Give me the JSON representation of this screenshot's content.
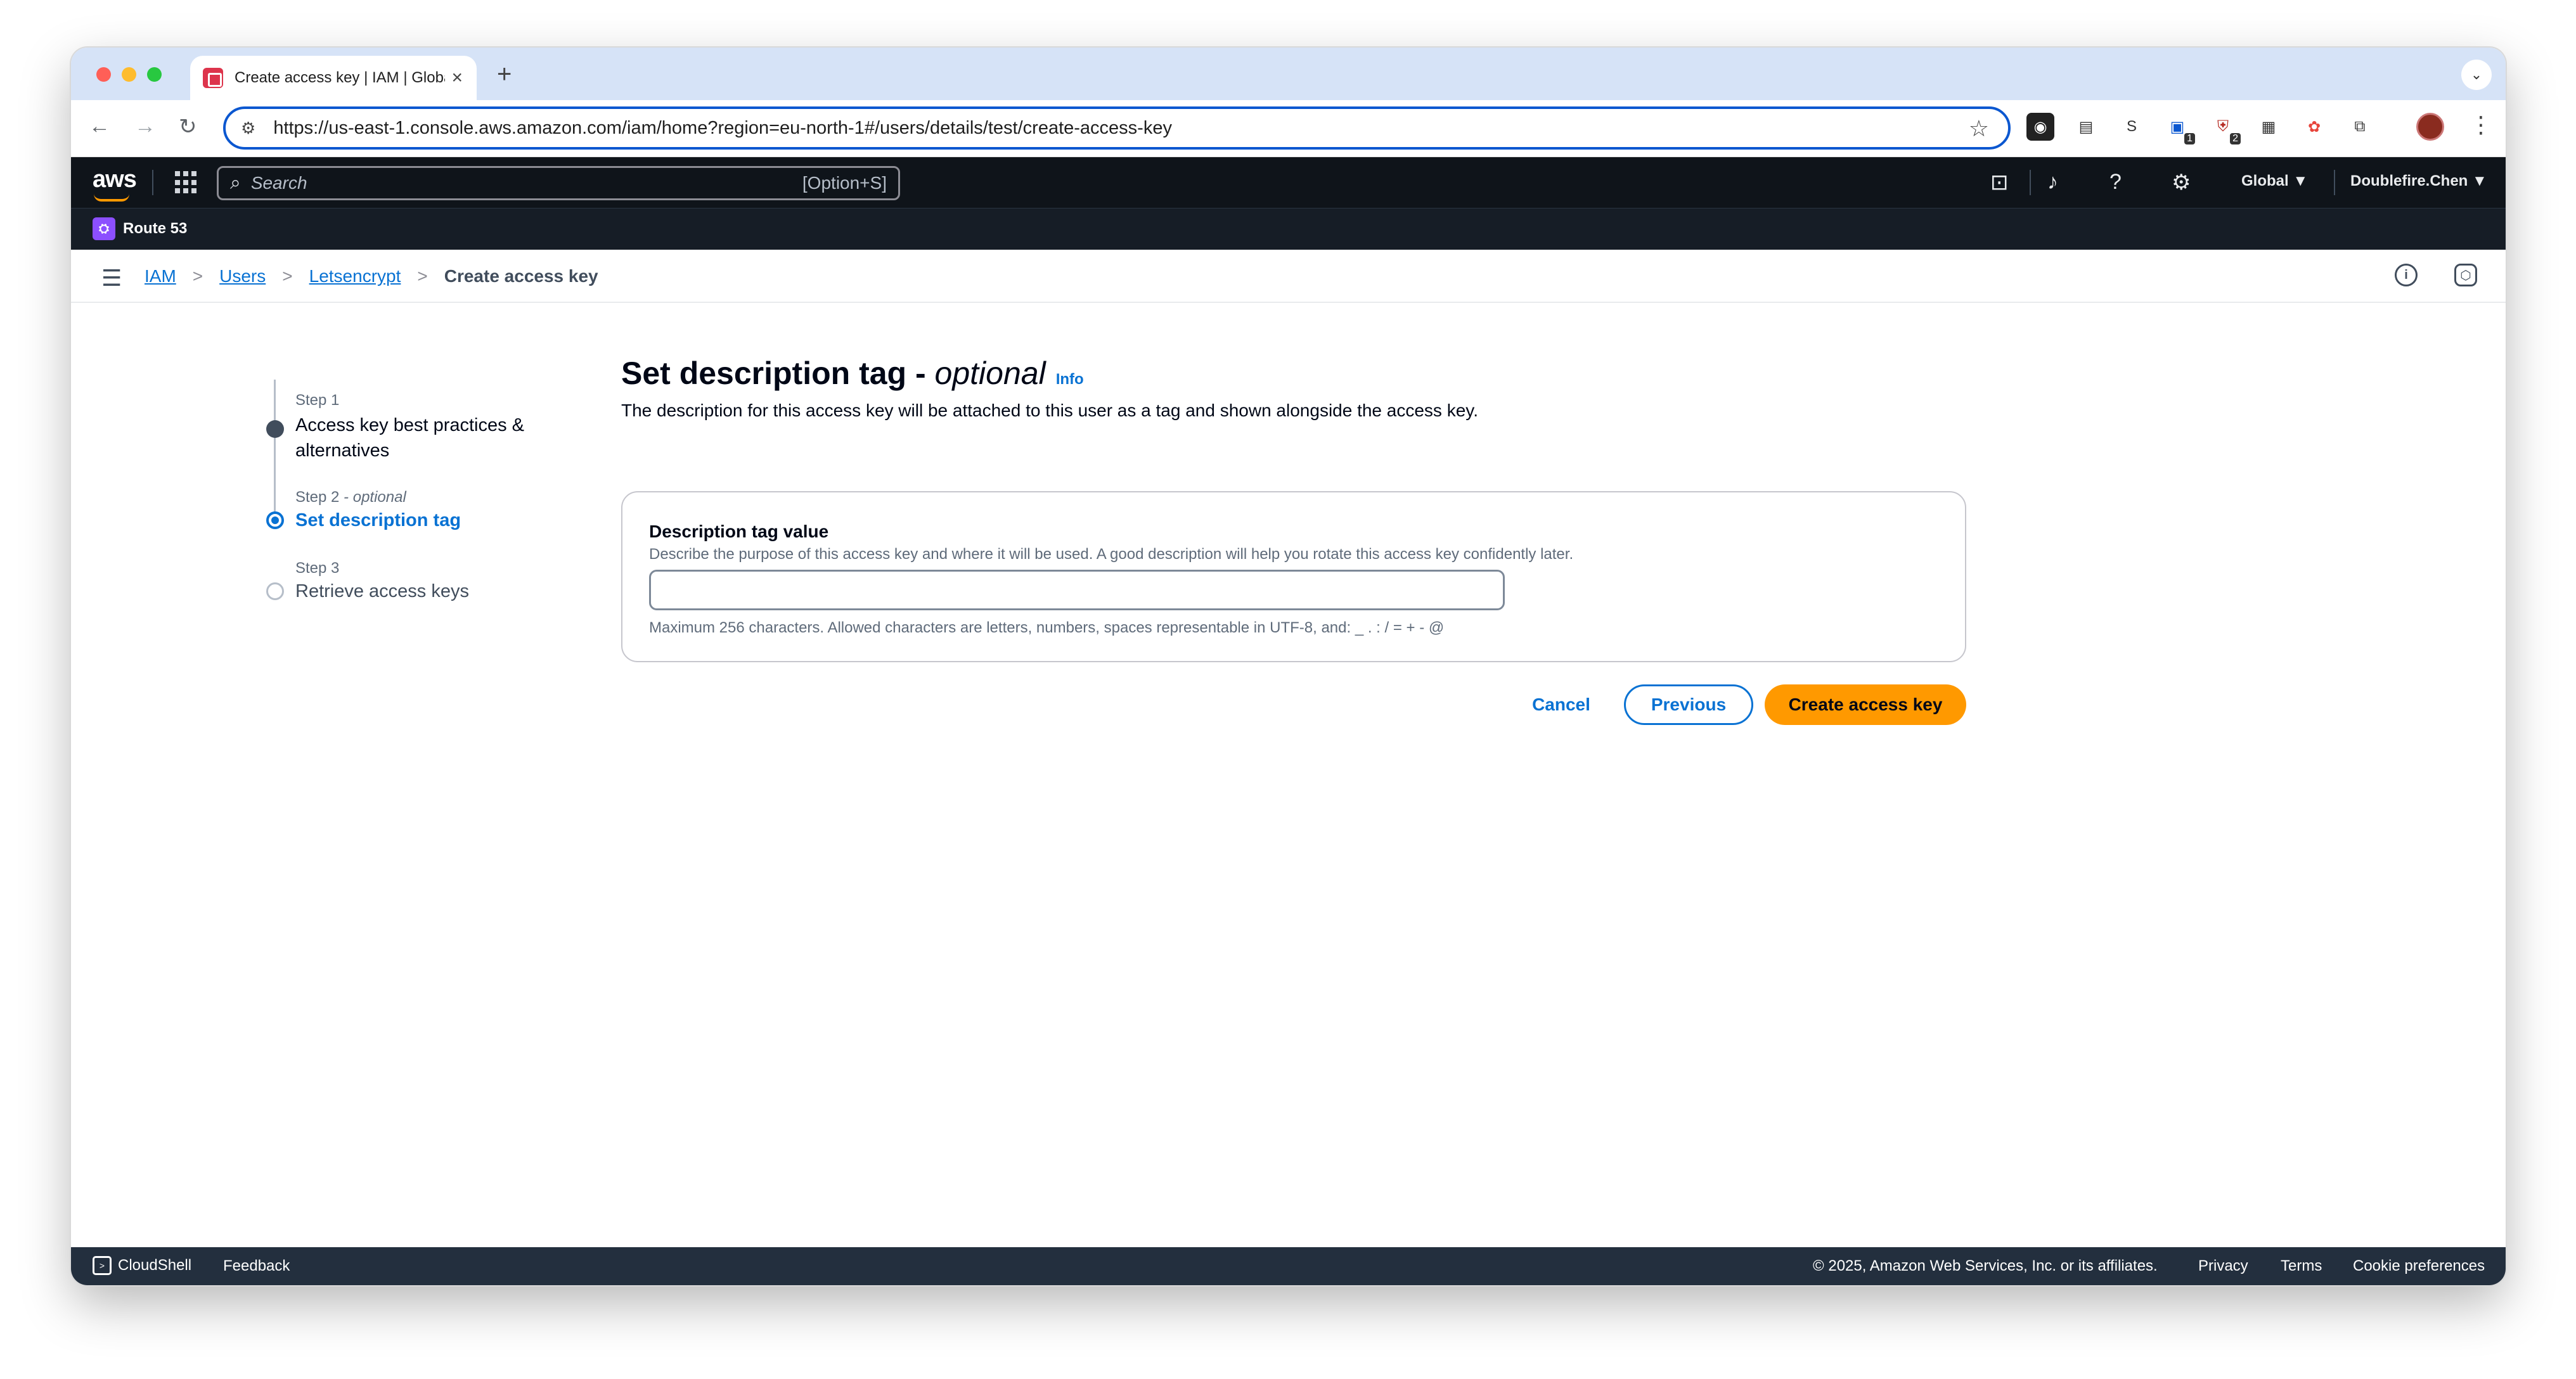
{
  "browser": {
    "tab_title": "Create access key | IAM | Global",
    "new_tab": "+",
    "close": "×",
    "url": "https://us-east-1.console.aws.amazon.com/iam/home?region=eu-north-1#/users/details/test/create-access-key",
    "extension_badges": [
      "1",
      "2"
    ]
  },
  "aws_nav": {
    "logo": "aws",
    "search_placeholder": "Search",
    "search_shortcut": "[Option+S]",
    "region": "Global ▼",
    "account": "Doublefire.Chen ▼",
    "service": "Route 53"
  },
  "breadcrumb": {
    "items": [
      "IAM",
      "Users",
      "Letsencrypt"
    ],
    "current": "Create access key",
    "separator": ">"
  },
  "steps": [
    {
      "num": "Step 1",
      "label": "Access key best practices & alternatives",
      "state": "completed"
    },
    {
      "num": "Step 2",
      "num_suffix": " - optional",
      "label": "Set description tag",
      "state": "current"
    },
    {
      "num": "Step 3",
      "label": "Retrieve access keys",
      "state": "pending"
    }
  ],
  "main": {
    "title": "Set description tag -",
    "title_optional": "optional",
    "info": "Info",
    "description": "The description for this access key will be attached to this user as a tag and shown alongside the access key.",
    "field_label": "Description tag value",
    "field_hint": "Describe the purpose of this access key and where it will be used. A good description will help you rotate this access key confidently later.",
    "field_value": "",
    "field_constraint": "Maximum 256 characters. Allowed characters are letters, numbers, spaces representable in UTF-8, and: _ . : / = + - @"
  },
  "actions": {
    "cancel": "Cancel",
    "previous": "Previous",
    "create": "Create access key"
  },
  "footer": {
    "cloudshell": "CloudShell",
    "feedback": "Feedback",
    "copyright": "© 2025, Amazon Web Services, Inc. or its affiliates.",
    "privacy": "Privacy",
    "terms": "Terms",
    "cookies": "Cookie preferences"
  },
  "colors": {
    "accent": "#0972d3",
    "primary_button": "#ff9900",
    "nav_bg": "#0f141a",
    "footer_bg": "#232f3e"
  }
}
